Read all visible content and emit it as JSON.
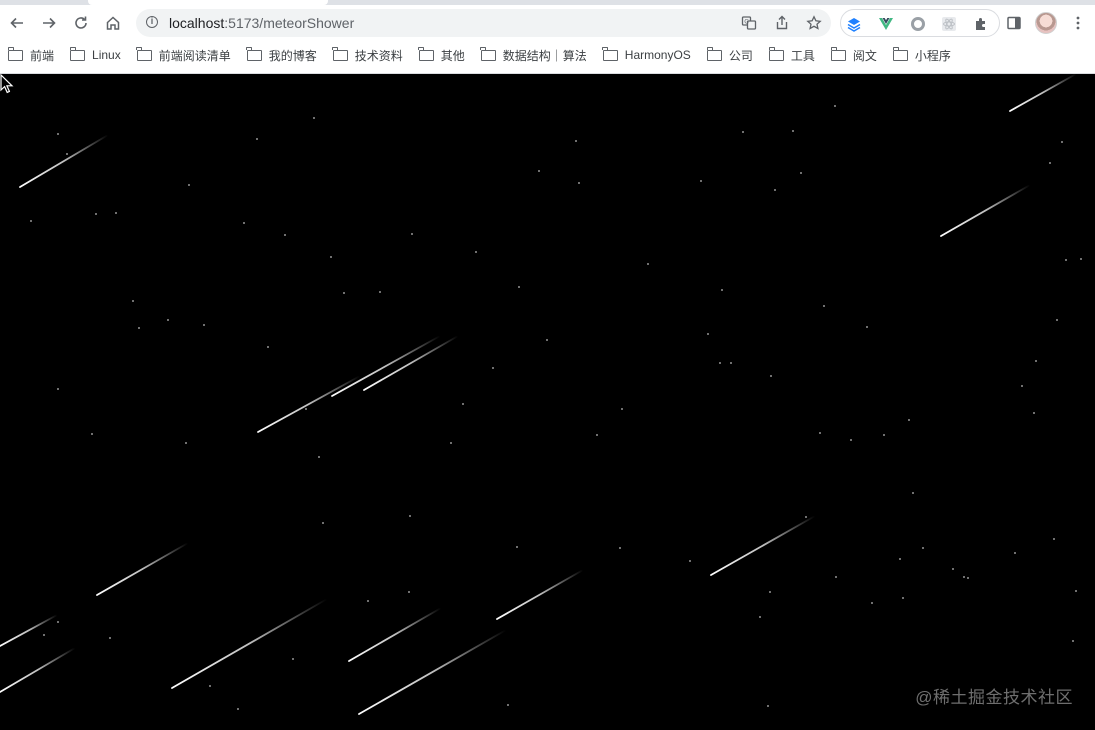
{
  "browser": {
    "url_host": "localhost",
    "url_path": ":5173/meteorShower",
    "icons": {
      "back": "arrow-left-icon",
      "forward": "arrow-right-icon",
      "reload": "reload-icon",
      "home": "home-icon",
      "site_info": "info-icon",
      "translate": "translate-icon",
      "share": "share-icon",
      "bookmark_star": "star-icon",
      "extensions": "puzzle-icon",
      "side_panel": "side-panel-icon",
      "menu": "kebab-menu-icon"
    }
  },
  "bookmarks": [
    {
      "label": "前端"
    },
    {
      "label": "Linux"
    },
    {
      "label": "前端阅读清单"
    },
    {
      "label": "我的博客"
    },
    {
      "label": "技术资料"
    },
    {
      "label": "其他"
    },
    {
      "label": "数据结构｜算法"
    },
    {
      "label": "HarmonyOS"
    },
    {
      "label": "公司"
    },
    {
      "label": "工具"
    },
    {
      "label": "阅文"
    },
    {
      "label": "小程序"
    }
  ],
  "page": {
    "background": "#000000",
    "meteor_color": "#ffffff",
    "star_color": "#ffffff",
    "watermark": "@稀土掘金技术社区"
  }
}
